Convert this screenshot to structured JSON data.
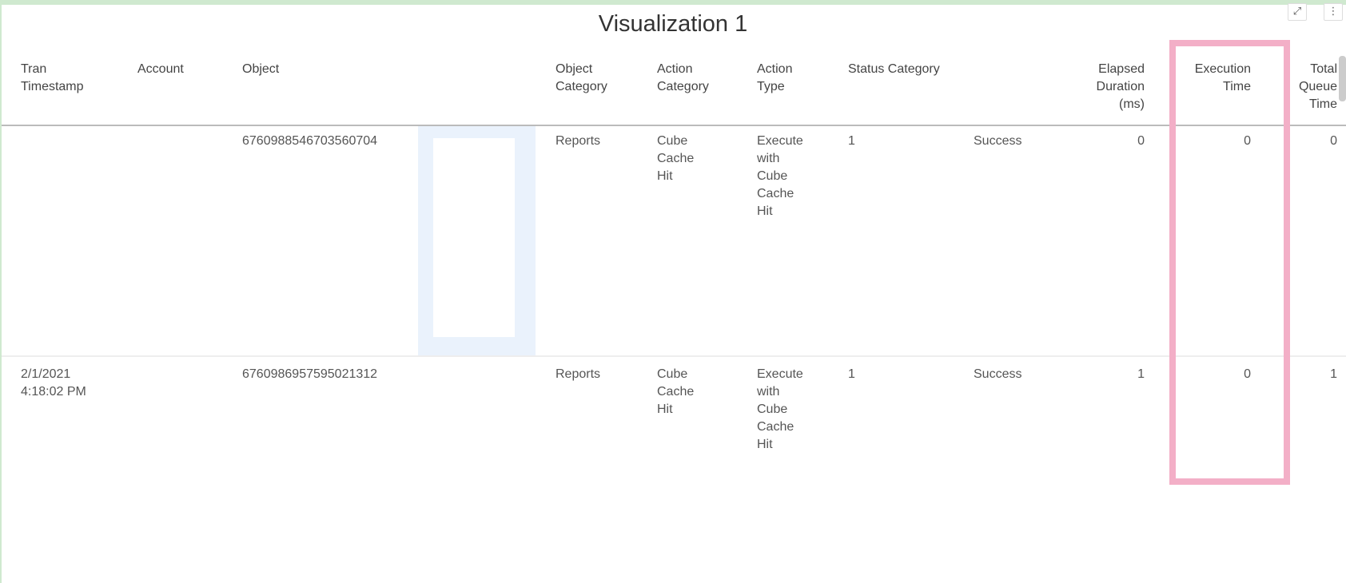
{
  "title": "Visualization 1",
  "icons": {
    "expand": "expand-icon",
    "menu": "more-vertical-icon"
  },
  "highlight_color": "#f3afc7",
  "columns": [
    {
      "label": "Tran\nTimestamp"
    },
    {
      "label": "Account"
    },
    {
      "label": "Object"
    },
    {
      "label": ""
    },
    {
      "label": "Object\nCategory"
    },
    {
      "label": "Action\nCategory"
    },
    {
      "label": "Action\nType"
    },
    {
      "label": "Status Category"
    },
    {
      "label": ""
    },
    {
      "label": "Elapsed\nDuration\n(ms)"
    },
    {
      "label": "Execution\nTime"
    },
    {
      "label": "Total\nQueue\nTime"
    }
  ],
  "rows": [
    {
      "tran_timestamp": "",
      "account": "",
      "object": "6760988546703560704",
      "object_category": "Reports",
      "action_category": "Cube\nCache\nHit",
      "action_type": "Execute\nwith\nCube\nCache\nHit",
      "status_code": "1",
      "status": "Success",
      "elapsed": "0",
      "execution": "0",
      "queue": "0"
    },
    {
      "tran_timestamp": "2/1/2021\n4:18:02 PM",
      "account": "",
      "object": "6760986957595021312",
      "object_category": "Reports",
      "action_category": "Cube\nCache\nHit",
      "action_type": "Execute\nwith\nCube\nCache\nHit",
      "status_code": "1",
      "status": "Success",
      "elapsed": "1",
      "execution": "0",
      "queue": "1"
    }
  ]
}
